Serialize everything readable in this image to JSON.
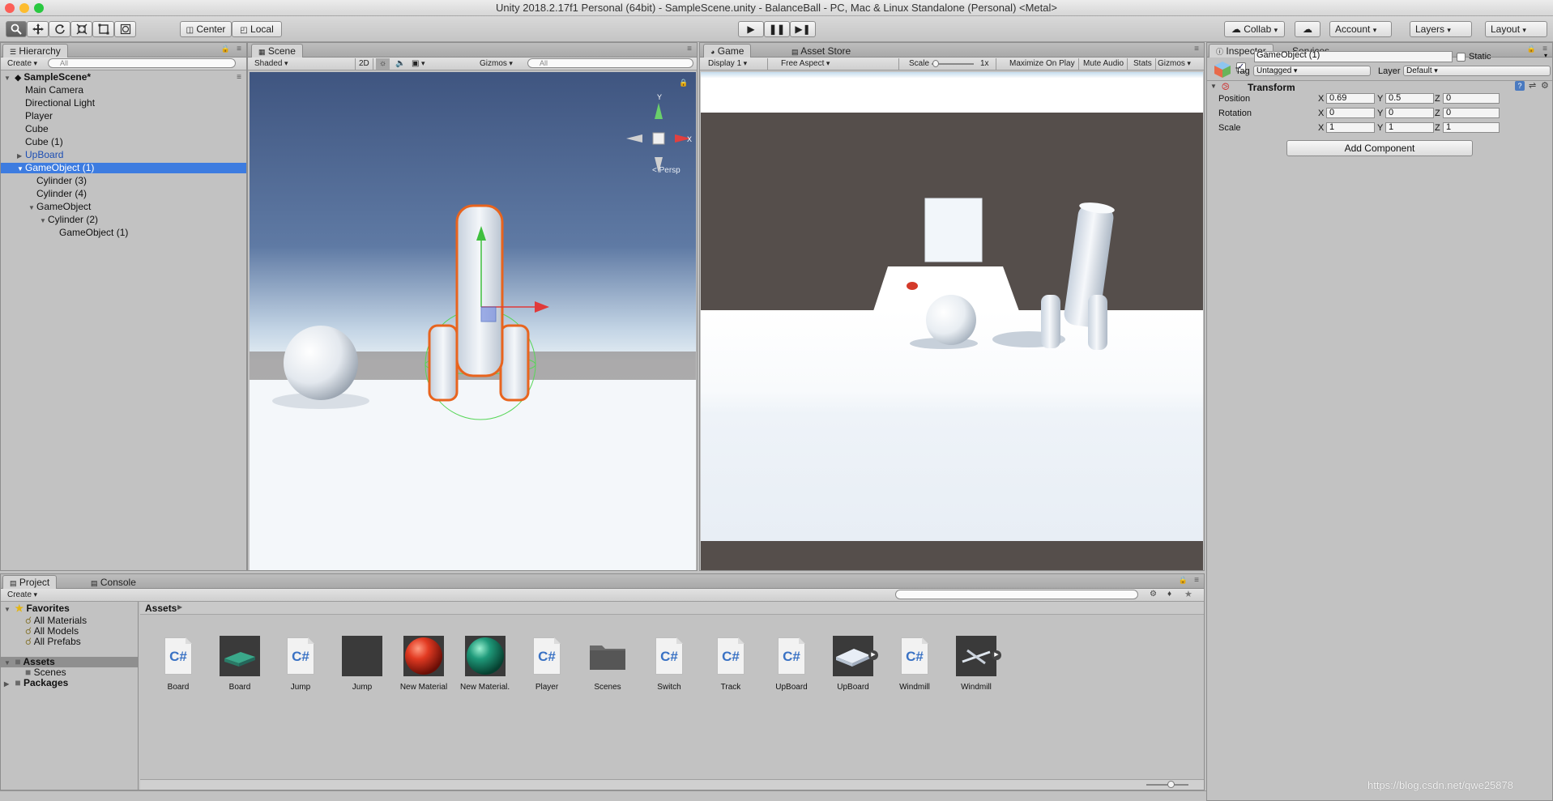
{
  "window": {
    "title": "Unity 2018.2.17f1 Personal (64bit) - SampleScene.unity - BalanceBall - PC, Mac & Linux Standalone (Personal) <Metal>"
  },
  "toolbar": {
    "center_label": "Center",
    "local_label": "Local",
    "collab_label": "Collab",
    "account_label": "Account",
    "layers_label": "Layers",
    "layout_label": "Layout"
  },
  "hierarchy": {
    "tab": "Hierarchy",
    "create_label": "Create",
    "search_placeholder": "All",
    "scene_name": "SampleScene*",
    "items": [
      {
        "label": "Main Camera",
        "depth": 1
      },
      {
        "label": "Directional Light",
        "depth": 1
      },
      {
        "label": "Player",
        "depth": 1
      },
      {
        "label": "Cube",
        "depth": 1
      },
      {
        "label": "Cube (1)",
        "depth": 1
      },
      {
        "label": "UpBoard",
        "depth": 1
      },
      {
        "label": "GameObject (1)",
        "depth": 1
      },
      {
        "label": "Cylinder (3)",
        "depth": 2
      },
      {
        "label": "Cylinder (4)",
        "depth": 2
      },
      {
        "label": "GameObject",
        "depth": 2
      },
      {
        "label": "Cylinder (2)",
        "depth": 3
      },
      {
        "label": "GameObject (1)",
        "depth": 4
      }
    ]
  },
  "scene": {
    "tab": "Scene",
    "shading": "Shaded",
    "mode_2d": "2D",
    "gizmos_label": "Gizmos",
    "search_placeholder": "All",
    "persp_label": "Persp",
    "axis_y": "Y",
    "axis_x": "X"
  },
  "game": {
    "tab": "Game",
    "asset_store_tab": "Asset Store",
    "display": "Display 1",
    "aspect": "Free Aspect",
    "scale_label": "Scale",
    "scale_value": "1x",
    "maximize_label": "Maximize On Play",
    "mute_label": "Mute Audio",
    "stats_label": "Stats",
    "gizmos_label": "Gizmos"
  },
  "inspector": {
    "tab": "Inspector",
    "services_tab": "Services",
    "object_name": "GameObject (1)",
    "static_label": "Static",
    "tag_label": "Tag",
    "tag_value": "Untagged",
    "layer_label": "Layer",
    "layer_value": "Default",
    "transform_label": "Transform",
    "position_label": "Position",
    "rotation_label": "Rotation",
    "scale_label": "Scale",
    "position": {
      "x": "0.69",
      "y": "0.5",
      "z": "0"
    },
    "rotation": {
      "x": "0",
      "y": "0",
      "z": "0"
    },
    "scale": {
      "x": "1",
      "y": "1",
      "z": "1"
    },
    "add_component_label": "Add Component"
  },
  "project": {
    "tab": "Project",
    "console_tab": "Console",
    "create_label": "Create",
    "favorites_label": "Favorites",
    "favorites": [
      "All Materials",
      "All Models",
      "All Prefabs"
    ],
    "assets_label": "Assets",
    "scenes_label": "Scenes",
    "packages_label": "Packages",
    "breadcrumb": "Assets",
    "assets": [
      {
        "name": "Board",
        "kind": "script"
      },
      {
        "name": "Board",
        "kind": "prefab-board"
      },
      {
        "name": "Jump",
        "kind": "script"
      },
      {
        "name": "Jump",
        "kind": "prefab-dark"
      },
      {
        "name": "New Material",
        "kind": "material-red"
      },
      {
        "name": "New Material...",
        "kind": "material-green"
      },
      {
        "name": "Player",
        "kind": "script"
      },
      {
        "name": "Scenes",
        "kind": "folder"
      },
      {
        "name": "Switch",
        "kind": "script"
      },
      {
        "name": "Track",
        "kind": "script"
      },
      {
        "name": "UpBoard",
        "kind": "script"
      },
      {
        "name": "UpBoard",
        "kind": "prefab-upboard"
      },
      {
        "name": "Windmill",
        "kind": "script"
      },
      {
        "name": "Windmill",
        "kind": "prefab-windmill"
      }
    ]
  },
  "watermark": "https://blog.csdn.net/qwe25878",
  "colors": {
    "selection": "#3d7ce0",
    "play_area_floor": "#ffffff",
    "backdrop": "#554e4b"
  }
}
